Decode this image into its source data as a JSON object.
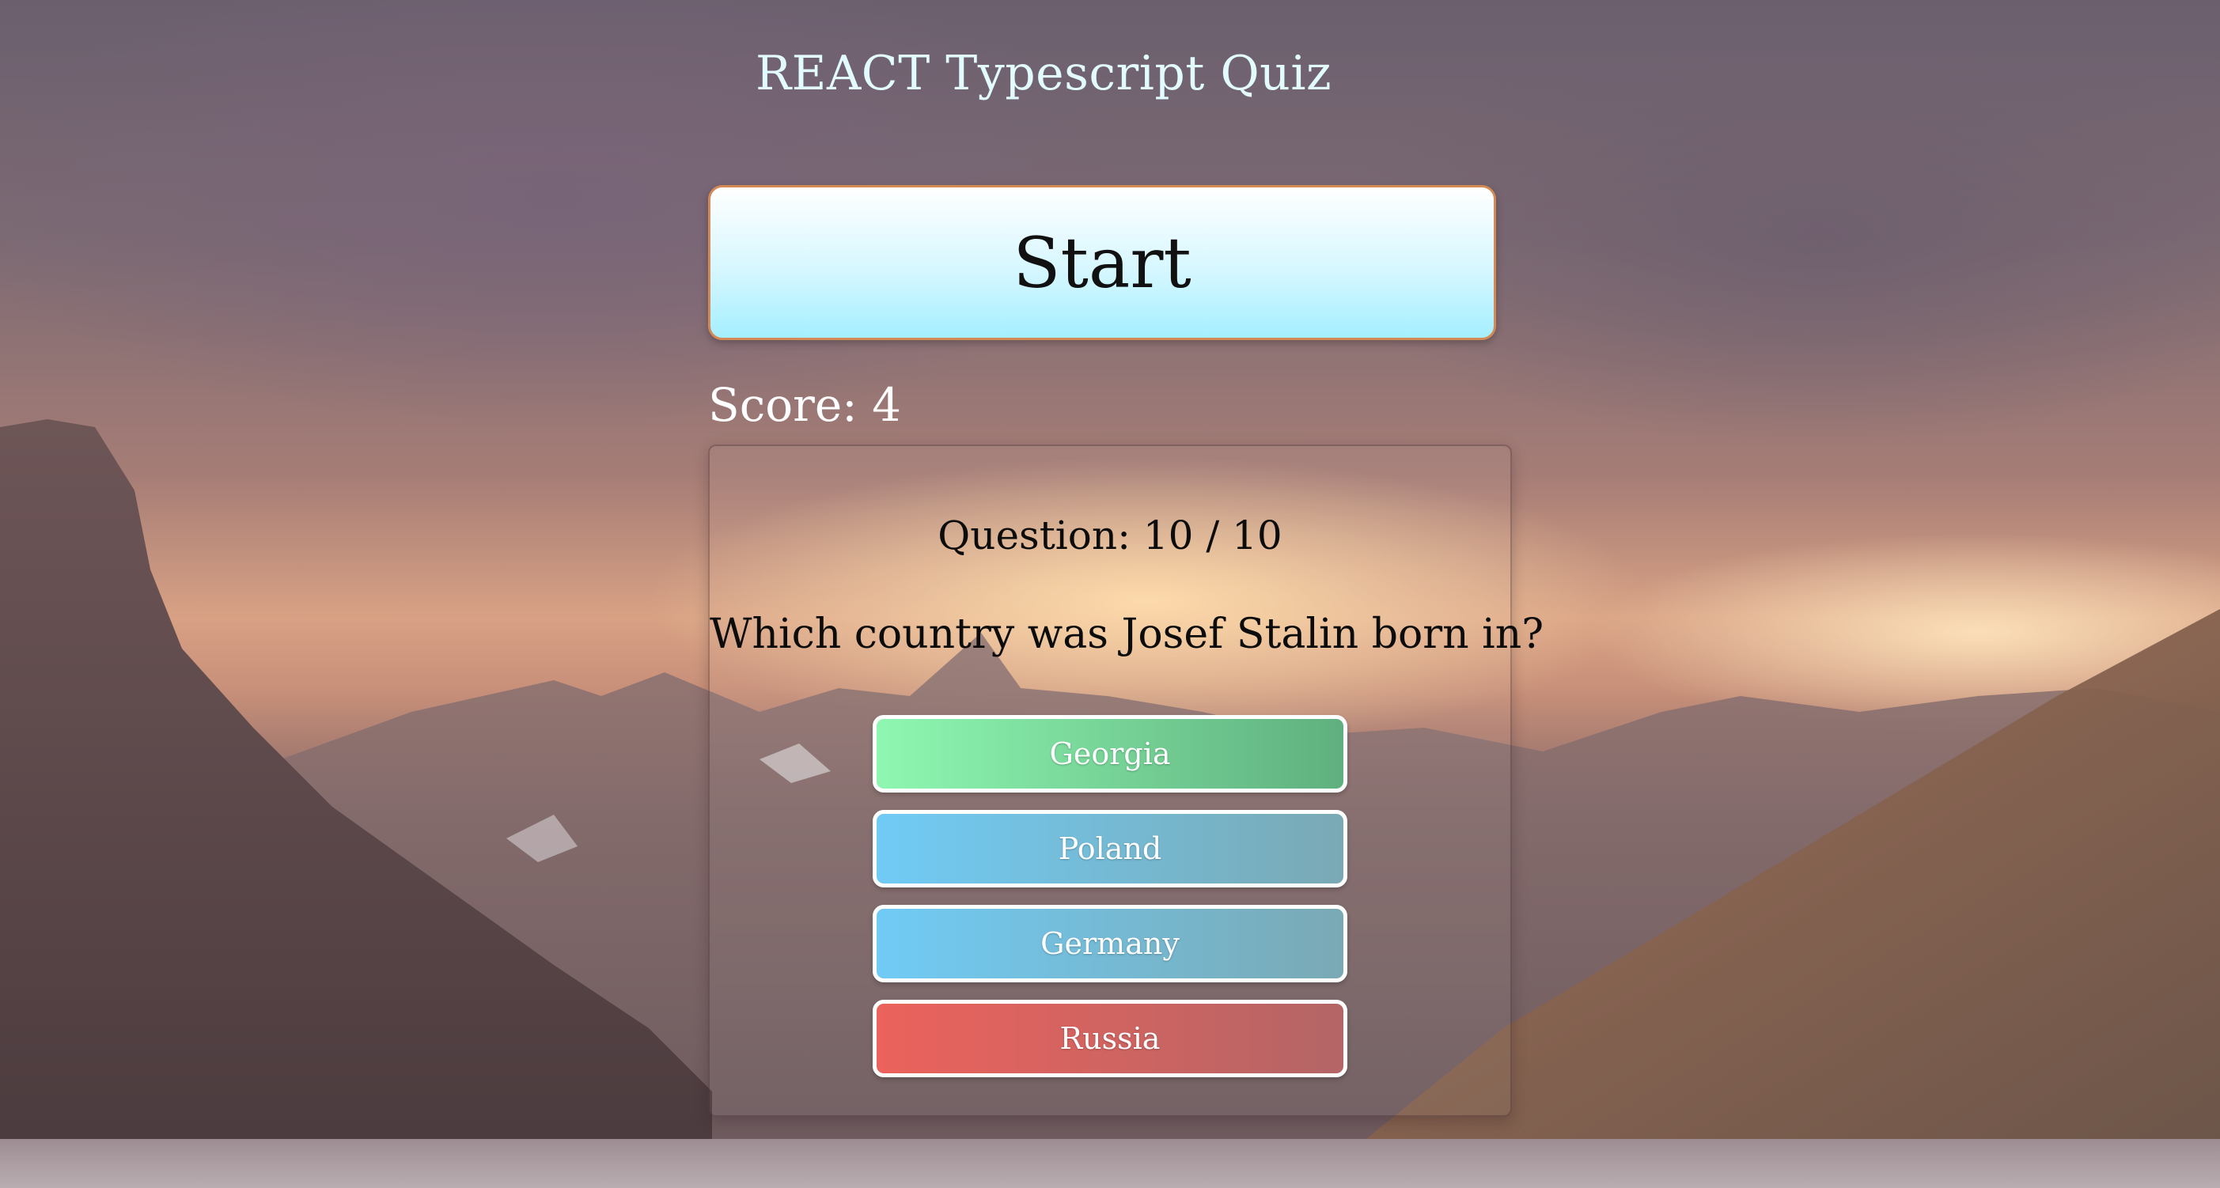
{
  "app": {
    "title": "REACT Typescript Quiz"
  },
  "controls": {
    "start_label": "Start"
  },
  "score": {
    "label": "Score: 4"
  },
  "question": {
    "number_label": "Question: 10 / 10",
    "text": "Which country was Josef Stalin born in?",
    "answers": [
      {
        "label": "Georgia",
        "state": "correct"
      },
      {
        "label": "Poland",
        "state": "neutral"
      },
      {
        "label": "Germany",
        "state": "neutral"
      },
      {
        "label": "Russia",
        "state": "wrong"
      }
    ]
  },
  "colors": {
    "title": "#e2fbff",
    "correct": "#5fb07e",
    "neutral": "#70cbf5",
    "wrong": "#ec625c",
    "start_border": "#d38a55"
  }
}
